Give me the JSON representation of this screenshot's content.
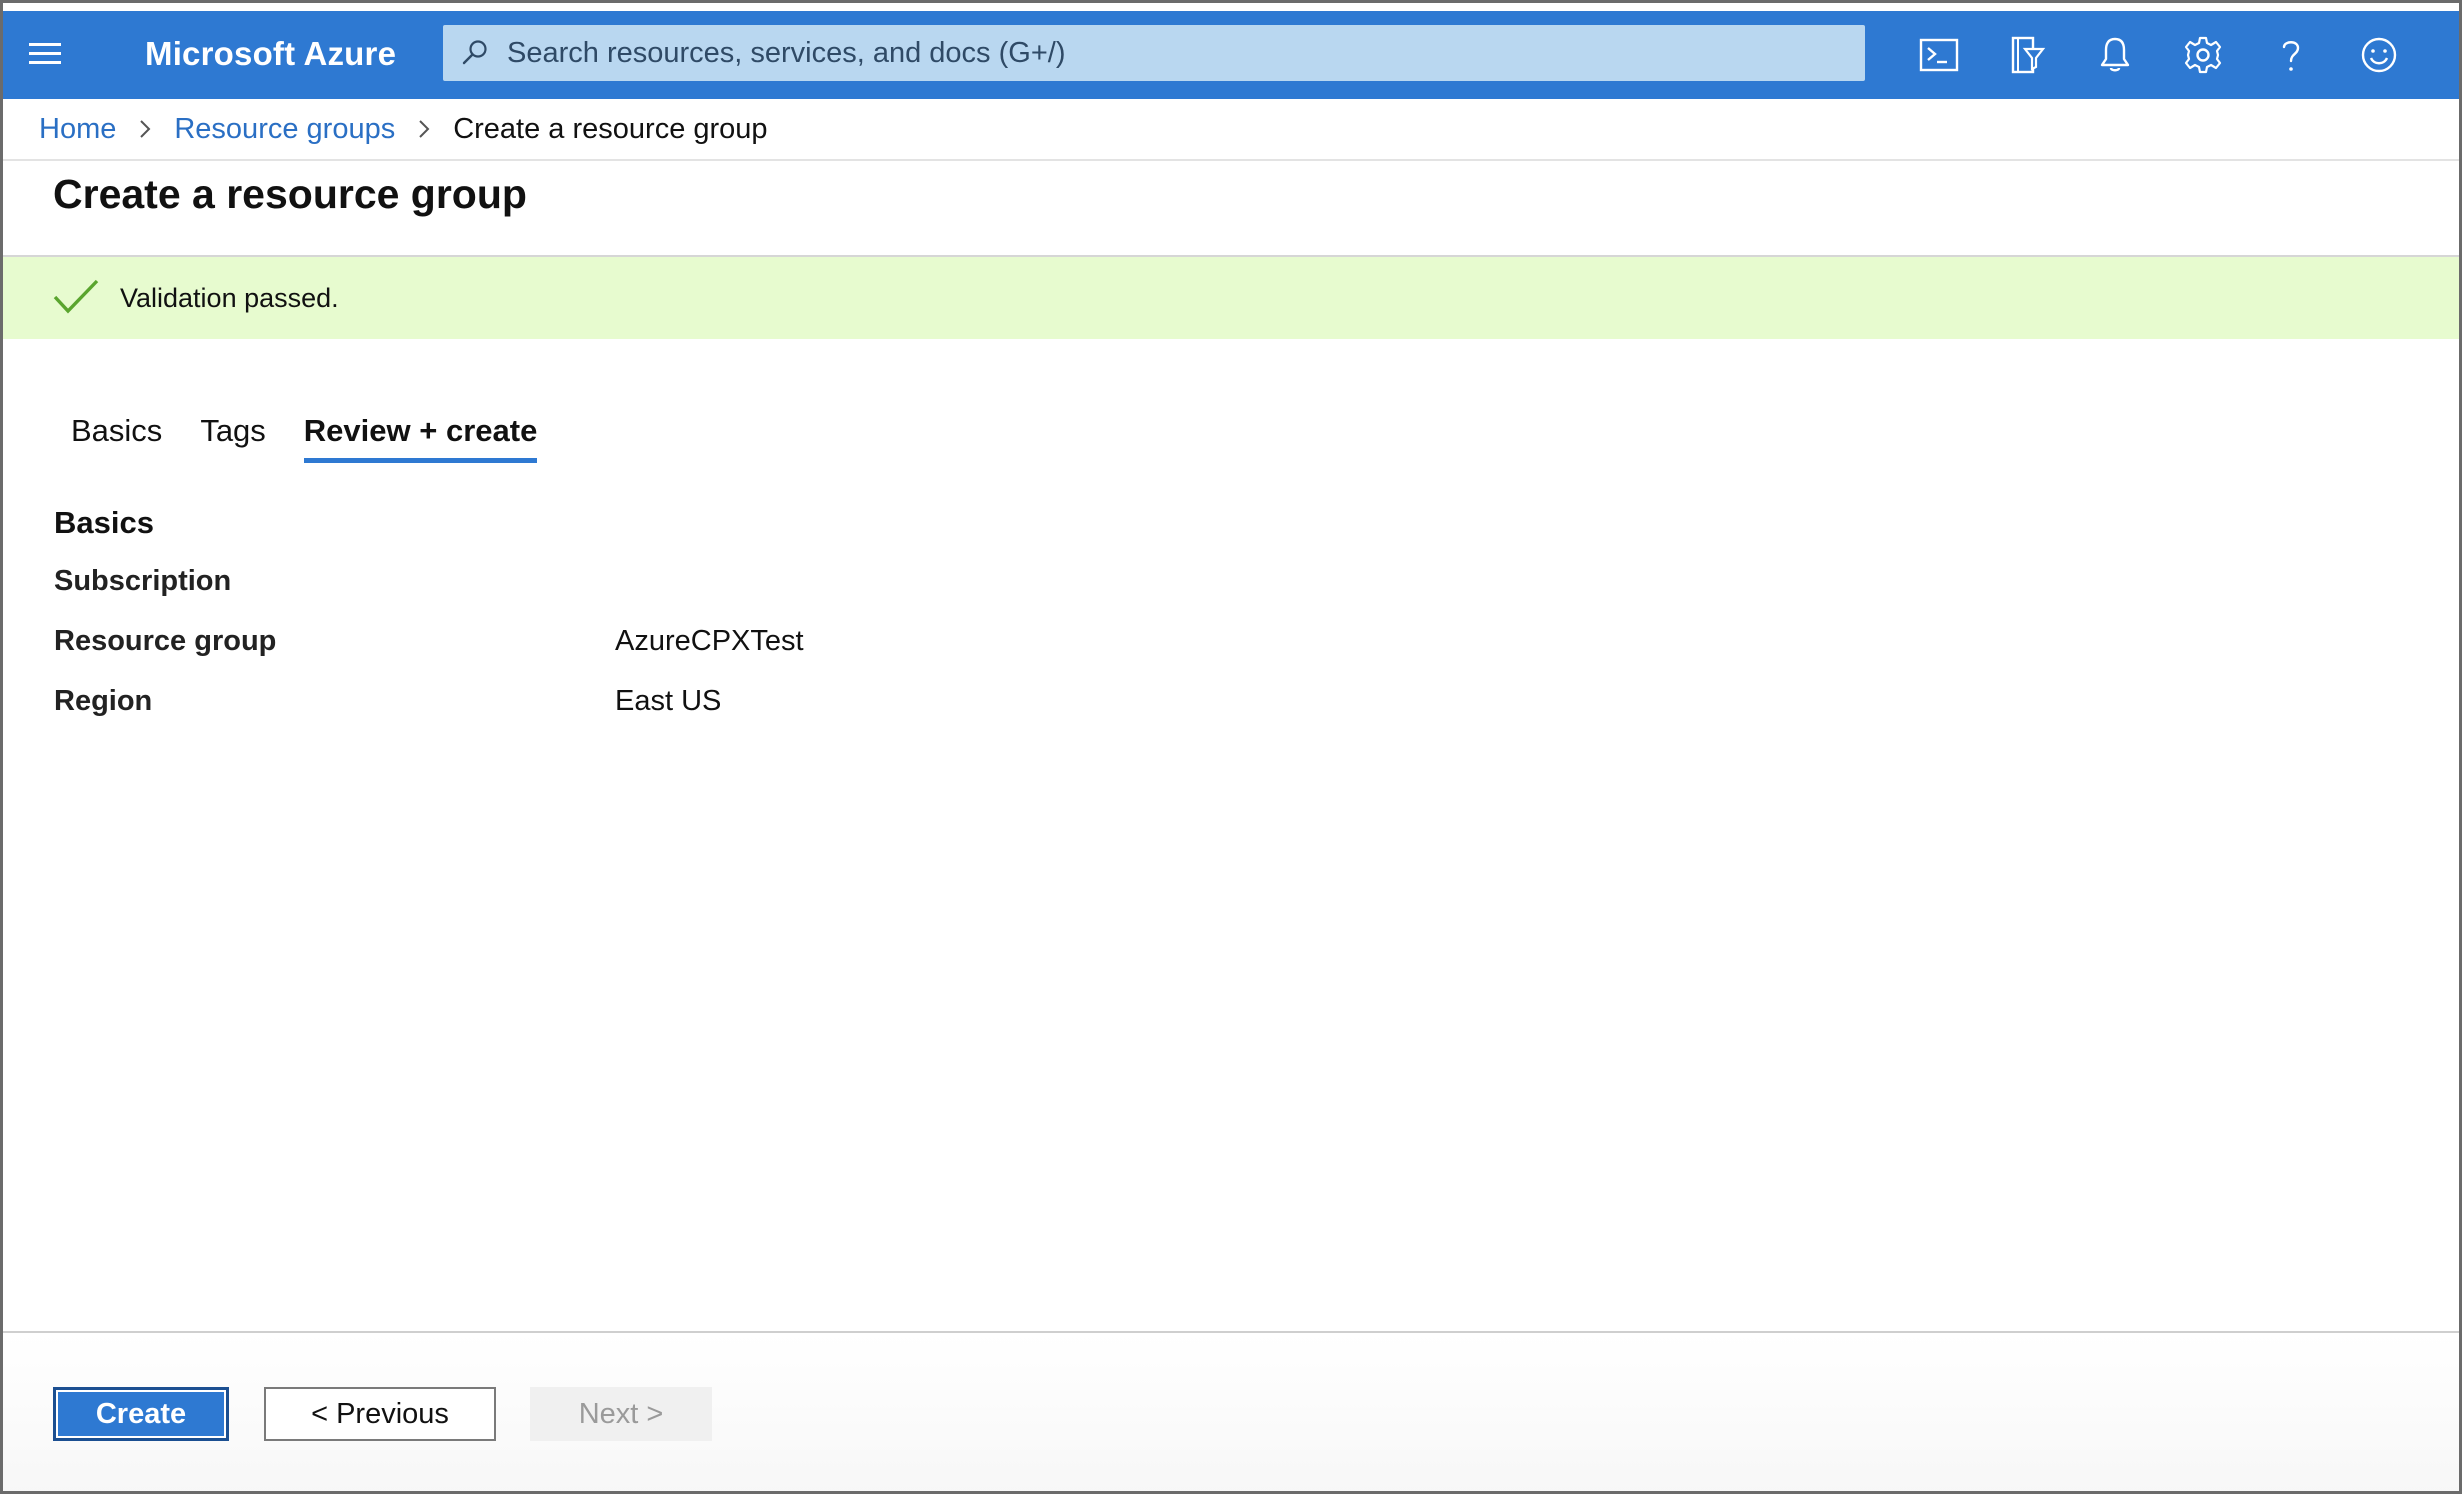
{
  "app": {
    "brand": "Microsoft Azure"
  },
  "search": {
    "placeholder": "Search resources, services, and docs (G+/)",
    "value": ""
  },
  "topbar_icons": [
    "cloud-shell-icon",
    "directory-filter-icon",
    "notifications-icon",
    "settings-icon",
    "help-icon",
    "feedback-icon"
  ],
  "breadcrumb": {
    "items": [
      {
        "label": "Home"
      },
      {
        "label": "Resource groups"
      },
      {
        "label": "Create a resource group"
      }
    ]
  },
  "page": {
    "title": "Create a resource group"
  },
  "banner": {
    "text": "Validation passed.",
    "color": "#e7fbcf"
  },
  "tabs": [
    {
      "label": "Basics",
      "active": false
    },
    {
      "label": "Tags",
      "active": false
    },
    {
      "label": "Review + create",
      "active": true
    }
  ],
  "summary": {
    "heading": "Basics",
    "rows": [
      {
        "label": "Subscription",
        "value": ""
      },
      {
        "label": "Resource group",
        "value": "AzureCPXTest"
      },
      {
        "label": "Region",
        "value": "East US"
      }
    ]
  },
  "footer": {
    "create_label": "Create",
    "previous_label": "< Previous",
    "next_label": "Next >"
  },
  "colors": {
    "accent": "#2e79d2",
    "link": "#2a6fc4",
    "success": "#5aa52e"
  }
}
